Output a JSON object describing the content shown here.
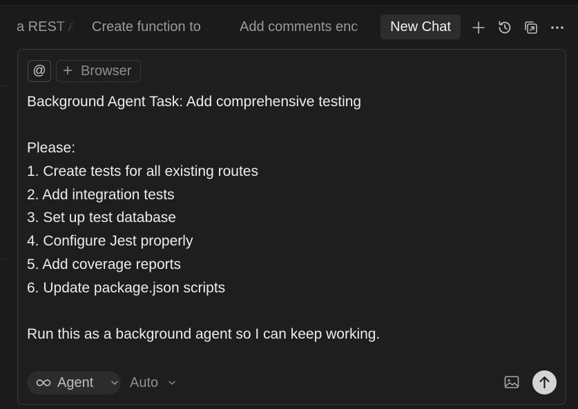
{
  "tabs": [
    {
      "label": "a REST API"
    },
    {
      "label": "Create function to"
    },
    {
      "label": "Add comments enc"
    }
  ],
  "active_tab": {
    "label": "New Chat"
  },
  "toolbar_icons": [
    "plus-icon",
    "history-icon",
    "open-in-window-icon",
    "more-icon"
  ],
  "composer": {
    "at_label": "@",
    "browser_label": "Browser",
    "message_lines": [
      "Background Agent Task: Add comprehensive testing",
      "",
      "Please:",
      "1. Create tests for all existing routes",
      "2. Add integration tests",
      "3. Set up test database",
      "4. Configure Jest properly",
      "5. Add coverage reports",
      "6. Update package.json scripts",
      "",
      "Run this as a background agent so I can keep working."
    ],
    "mode_label": "Agent",
    "model_label": "Auto"
  },
  "colors": {
    "background": "#1b1b1b",
    "composer_bg": "#1e1e1e",
    "active_tab_bg": "#2d2d2d",
    "send_button": "#d4d4d4"
  }
}
